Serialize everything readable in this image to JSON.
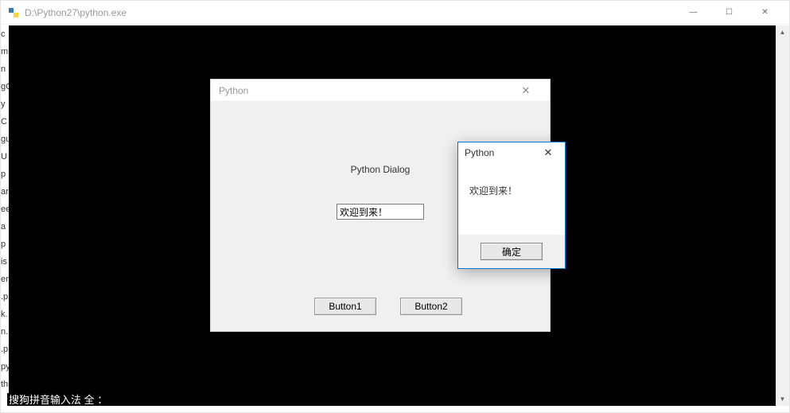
{
  "main_window": {
    "title": "D:\\Python27\\python.exe",
    "minimize": "—",
    "maximize": "☐",
    "close": "✕"
  },
  "scrollbar": {
    "up": "▲",
    "down": "▼"
  },
  "left_fragments": [
    "c",
    "m",
    "n",
    "gC",
    "y",
    "C",
    "gu",
    "U",
    "p",
    "ar",
    "ee",
    "a",
    "p",
    "is",
    "en",
    ".p",
    "k.",
    "n.",
    ".p",
    "py",
    "thi"
  ],
  "ime": "搜狗拼音输入法  全 ：",
  "dialog": {
    "title": "Python",
    "close": "✕",
    "label": "Python Dialog",
    "input_value": "欢迎到来！",
    "button1": "Button1",
    "button2": "Button2"
  },
  "msgbox": {
    "title": "Python",
    "close": "✕",
    "message": "欢迎到来！",
    "ok": "确定"
  }
}
